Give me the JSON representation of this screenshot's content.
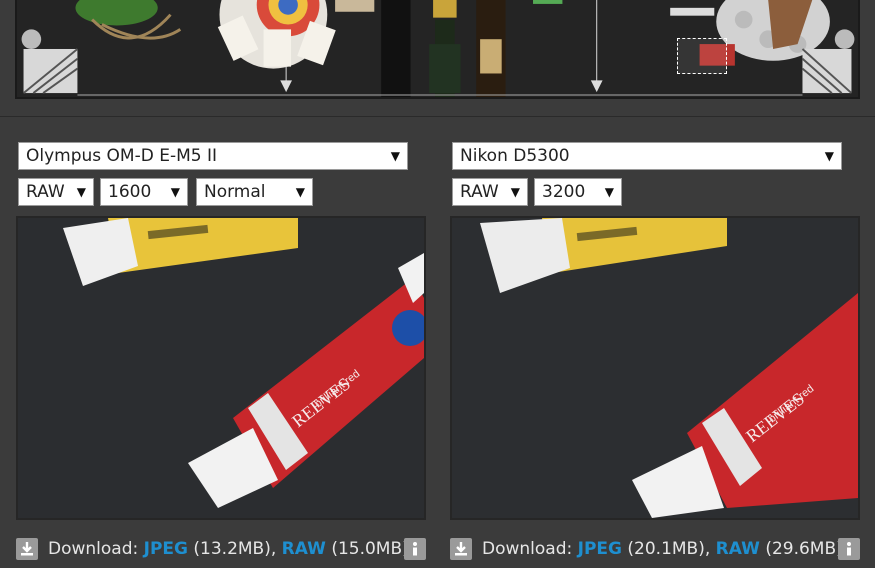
{
  "overview": {
    "crop_marker_label": "",
    "colors": {
      "background": "#242424",
      "marker": "#ffffff"
    }
  },
  "panels": [
    {
      "camera": "Olympus OM-D E-M5 II",
      "format": "RAW",
      "iso": "1600",
      "mode": "Normal",
      "download": {
        "prefix": "Download:",
        "jpeg_label": "JPEG",
        "jpeg_size": "(13.2MB),",
        "raw_label": "RAW",
        "raw_size": "(15.0MB)"
      }
    },
    {
      "camera": "Nikon D5300",
      "format": "RAW",
      "iso": "3200",
      "download": {
        "prefix": "Download:",
        "jpeg_label": "JPEG",
        "jpeg_size": "(20.1MB),",
        "raw_label": "RAW",
        "raw_size": "(29.6MB)"
      }
    }
  ],
  "icons": {
    "download": "download-icon",
    "info": "info-icon",
    "dropdown": "caret-down-icon"
  },
  "colors": {
    "page_background": "#3b3b3b",
    "link": "#1e8fd0",
    "tube_yellow": "#e8c43a",
    "tube_red": "#c8272b",
    "cap_white": "#f2f2f2"
  }
}
